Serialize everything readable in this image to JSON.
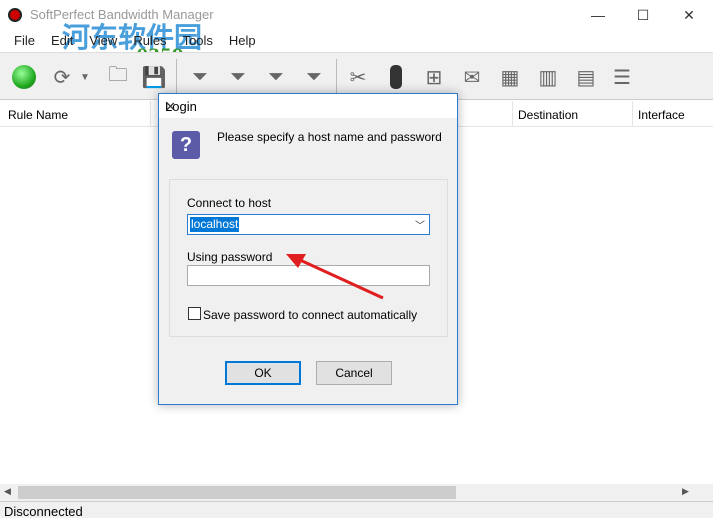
{
  "window": {
    "title": "SoftPerfect Bandwidth Manager",
    "minimize": "—",
    "maximize": "☐",
    "close": "✕"
  },
  "watermark": {
    "text": "河东软件园",
    "url": "www.pc0359.cn"
  },
  "menu": [
    "File",
    "Edit",
    "View",
    "Rules",
    "Tools",
    "Help"
  ],
  "toolbar": {
    "icons": [
      "start",
      "refresh",
      "open",
      "save",
      "add-rule",
      "edit-rule",
      "delete-rule",
      "rule-stats",
      "settings",
      "traffic-light",
      "network",
      "mail",
      "calendar",
      "report",
      "log",
      "bars"
    ]
  },
  "list": {
    "columns": [
      "Rule Name",
      "Destination",
      "Interface"
    ]
  },
  "status": "Disconnected",
  "dialog": {
    "title": "Login",
    "prompt": "Please specify a host name and password",
    "host_label": "Connect to host",
    "host_value": "localhost",
    "password_label": "Using password",
    "password_value": "",
    "save_label": "Save password to connect automatically",
    "save_checked": false,
    "ok": "OK",
    "cancel": "Cancel"
  }
}
